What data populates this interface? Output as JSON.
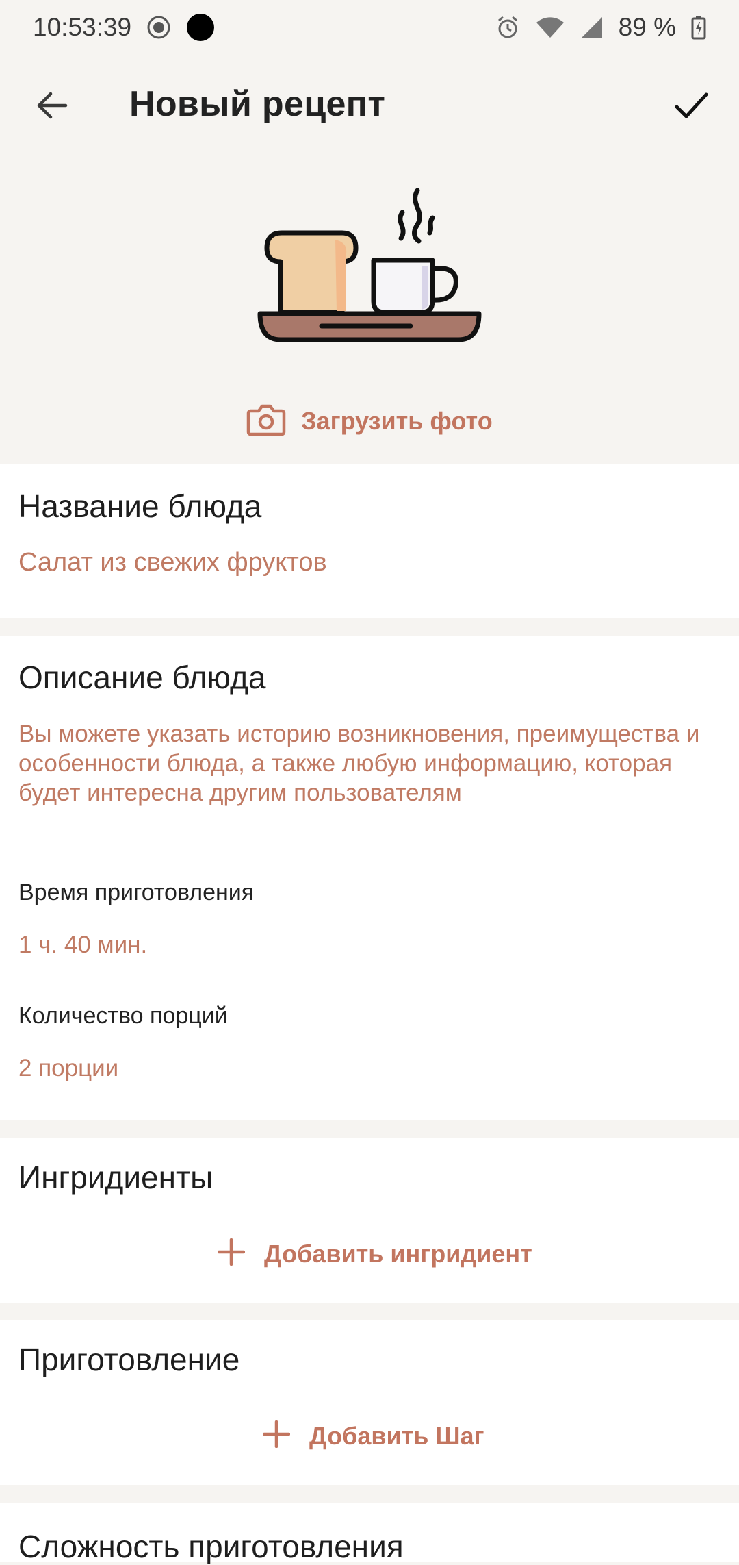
{
  "status_bar": {
    "time": "10:53:39",
    "battery": "89 %",
    "icons": [
      "record-icon",
      "dot-icon",
      "alarm-icon",
      "wifi-icon",
      "signal-icon",
      "battery-icon"
    ]
  },
  "app_bar": {
    "title": "Новый рецепт",
    "back_icon": "arrow-left-icon",
    "confirm_icon": "check-icon"
  },
  "photo": {
    "upload_label": "Загрузить фото",
    "icon": "camera-icon"
  },
  "dish_name": {
    "label": "Название блюда",
    "value": "Салат из свежих фруктов"
  },
  "description": {
    "label": "Описание блюда",
    "placeholder": "Вы можете указать историю возникновения, преимущества и особенности блюда, а также любую информацию, которая будет интересна другим пользователям",
    "cook_time_label": "Время приготовления",
    "cook_time_value": "1 ч. 40 мин.",
    "portions_label": "Количество порций",
    "portions_value": "2 порции"
  },
  "ingredients": {
    "label": "Ингридиенты",
    "add_label": "Добавить ингридиент"
  },
  "steps": {
    "label": "Приготовление",
    "add_label": "Добавить Шаг"
  },
  "difficulty": {
    "label": "Сложность приготовления"
  },
  "colors": {
    "accent": "#c2755f",
    "background": "#f6f4f1",
    "card": "#ffffff",
    "text": "#1e1e1e"
  }
}
